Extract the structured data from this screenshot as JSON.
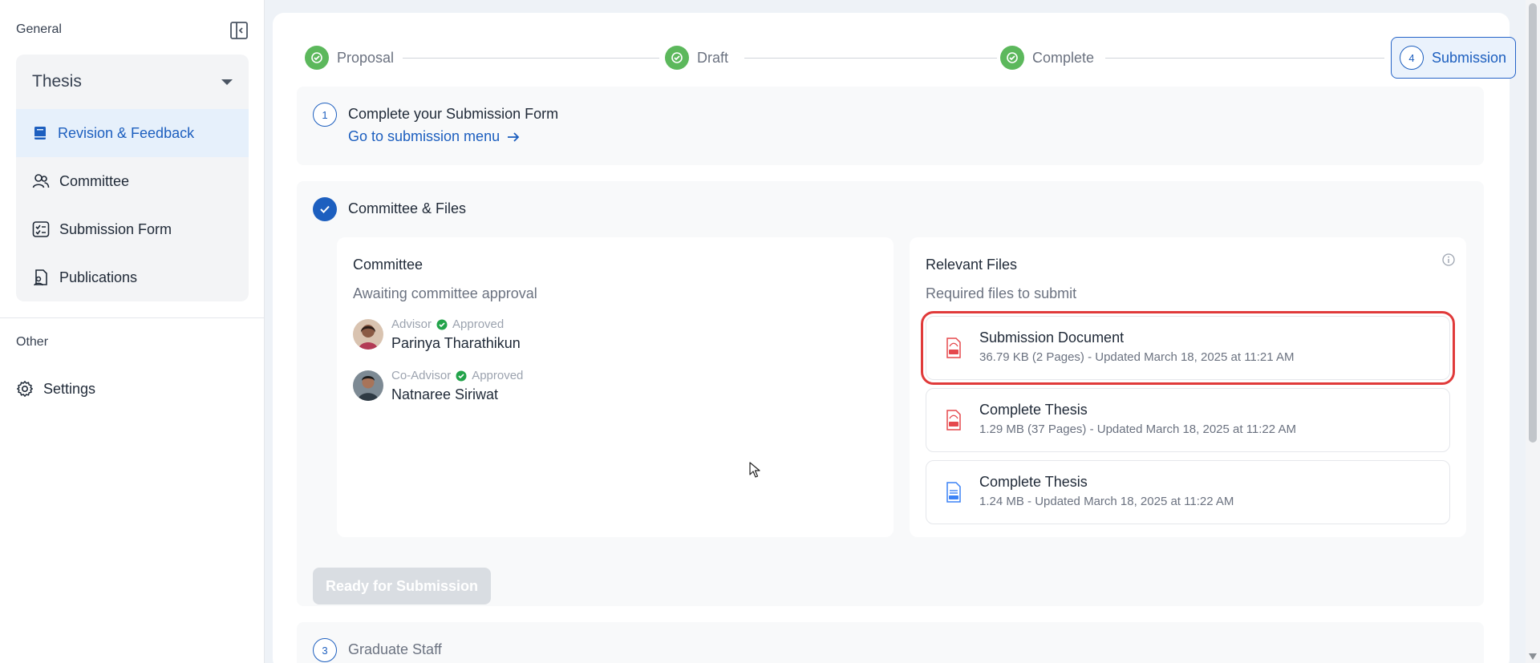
{
  "sidebar": {
    "general_label": "General",
    "other_label": "Other",
    "group_title": "Thesis",
    "items": [
      {
        "label": "Revision & Feedback",
        "icon": "book-icon",
        "active": true
      },
      {
        "label": "Committee",
        "icon": "users-icon",
        "active": false
      },
      {
        "label": "Submission Form",
        "icon": "checklist-icon",
        "active": false
      },
      {
        "label": "Publications",
        "icon": "document-user-icon",
        "active": false
      }
    ],
    "settings_label": "Settings"
  },
  "stepper": {
    "steps": [
      {
        "label": "Proposal",
        "status": "done"
      },
      {
        "label": "Draft",
        "status": "done"
      },
      {
        "label": "Complete",
        "status": "done"
      },
      {
        "label": "Submission",
        "status": "current",
        "number": "4"
      }
    ]
  },
  "step1": {
    "number": "1",
    "title": "Complete your Submission Form",
    "link": "Go to submission menu"
  },
  "step2": {
    "title": "Committee & Files",
    "committee": {
      "title": "Committee",
      "status": "Awaiting committee approval",
      "members": [
        {
          "role": "Advisor",
          "approval": "Approved",
          "name": "Parinya Tharathikun"
        },
        {
          "role": "Co-Advisor",
          "approval": "Approved",
          "name": "Natnaree Siriwat"
        }
      ]
    },
    "files": {
      "title": "Relevant Files",
      "subtitle": "Required files to submit",
      "items": [
        {
          "name": "Submission Document",
          "meta": "36.79 KB (2 Pages) - Updated March 18, 2025 at 11:21 AM",
          "type": "pdf"
        },
        {
          "name": "Complete Thesis",
          "meta": "1.29 MB (37 Pages) - Updated March 18, 2025 at 11:22 AM",
          "type": "pdf"
        },
        {
          "name": "Complete Thesis",
          "meta": "1.24 MB - Updated March 18, 2025 at 11:22 AM",
          "type": "doc"
        }
      ]
    },
    "button": "Ready for Submission"
  },
  "step3": {
    "number": "3",
    "title": "Graduate Staff"
  },
  "colors": {
    "accent": "#1d5fbf",
    "success": "#5cb85c",
    "highlight": "#e03a3a",
    "pdf": "#e5484d",
    "doc": "#3b82f6"
  }
}
